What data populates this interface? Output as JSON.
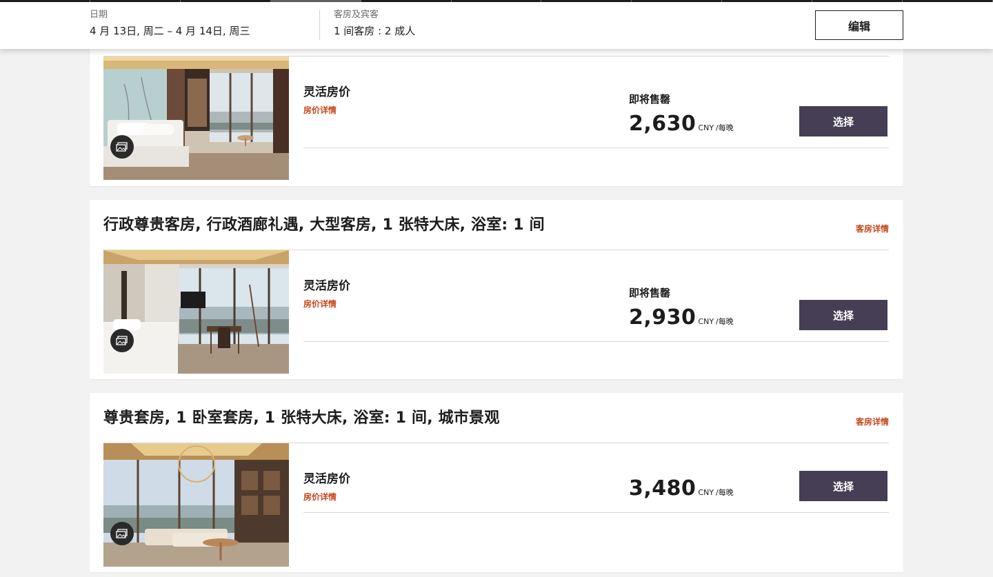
{
  "header": {
    "dates_label": "日期",
    "dates_value": "4 月 13日, 周二 – 4 月 14日, 周三",
    "guests_label": "客房及宾客",
    "guests_value": "1 间客房 : 2 成人",
    "edit_label": "编辑"
  },
  "rooms": [
    {
      "title": "",
      "details_link": "",
      "rate_name": "灵活房价",
      "rate_link": "房价详情",
      "availability": "即将售罄",
      "price": "2,630",
      "currency": "CNY",
      "per": "/每晚",
      "select_label": "选择"
    },
    {
      "title": "行政尊贵客房, 行政酒廊礼遇, 大型客房, 1 张特大床, 浴室: 1 间",
      "details_link": "客房详情",
      "rate_name": "灵活房价",
      "rate_link": "房价详情",
      "availability": "即将售罄",
      "price": "2,930",
      "currency": "CNY",
      "per": "/每晚",
      "select_label": "选择"
    },
    {
      "title": "尊贵套房, 1 卧室套房, 1 张特大床, 浴室: 1 间, 城市景观",
      "details_link": "客房详情",
      "rate_name": "灵活房价",
      "rate_link": "房价详情",
      "availability": "",
      "price": "3,480",
      "currency": "CNY",
      "per": "/每晚",
      "select_label": "选择"
    }
  ],
  "icons": {
    "gallery": "image-gallery-icon"
  },
  "colors": {
    "accent_link": "#c4471a",
    "select_button": "#453e55"
  }
}
